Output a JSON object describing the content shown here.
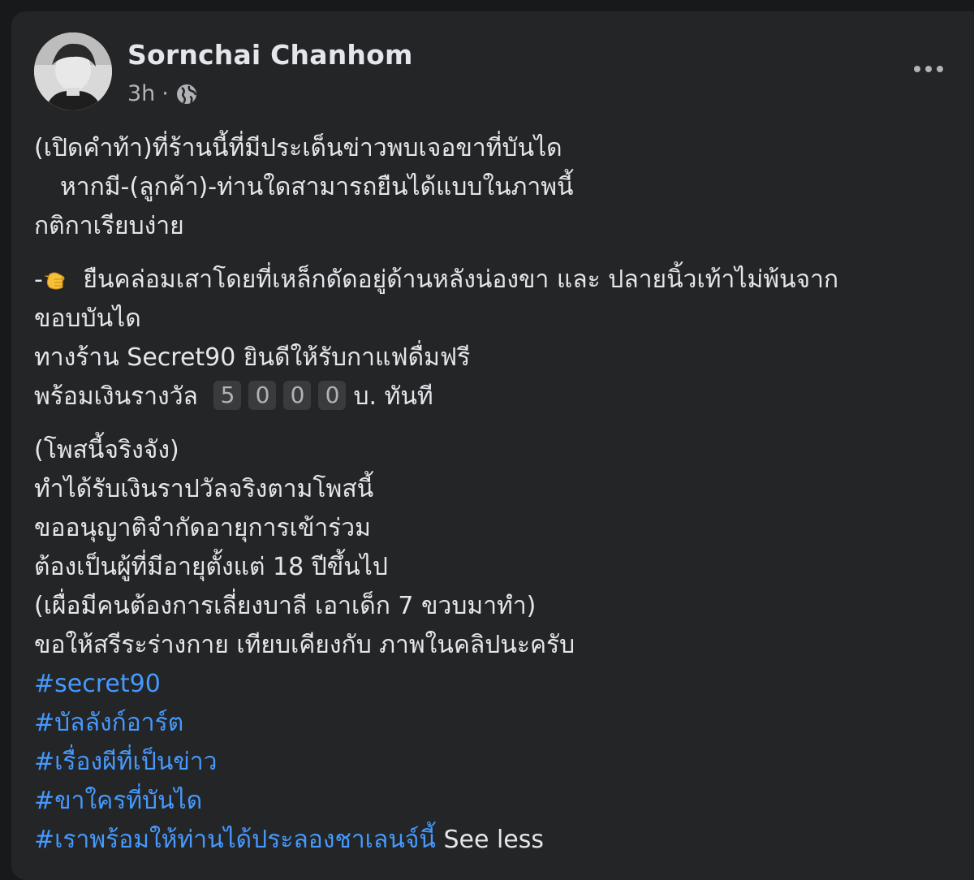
{
  "post": {
    "author": "Sornchai Chanhom",
    "time": "3h",
    "separator": "·",
    "privacy_icon": "globe-icon",
    "more_icon": "more-options-icon",
    "intro_lines": [
      "(เปิดคำท้า)ที่ร้านนี้ที่มีประเด็นข่าวพบเจอขาที่บันได",
      "หากมี-(ลูกค้า)-ท่านใดสามารถยืนได้แบบในภาพนี้",
      "กติกาเรียบง่าย"
    ],
    "rule": {
      "prefix": "-",
      "emoji": "pointing-hand-icon",
      "line1": "ยืนคล่อมเสาโดยที่เหล็กดัดอยู่ด้านหลังน่องขา และ ปลายนิ้วเท้าไม่พ้นจาก",
      "line2": "ขอบบันได",
      "line3": "ทางร้าน Secret90 ยินดีให้รับกาแฟดื่มฟรี",
      "prize_prefix": "พร้อมเงินรางวัล",
      "prize_digits": [
        "5",
        "0",
        "0",
        "0"
      ],
      "prize_suffix": "บ. ทันที"
    },
    "closing_lines": [
      "(โพสนี้จริงจัง)",
      "ทำได้รับเงินราปวัลจริงตามโพสนี้",
      "ขออนุญาติจำกัดอายุการเข้าร่วม",
      "ต้องเป็นผู้ที่มีอายุตั้งแต่ 18 ปีขึ้นไป",
      "(เผื่อมีคนต้องการเลี่ยงบาลี เอาเด็ก 7 ขวบมาทำ)",
      "ขอให้สรีระร่างกาย เทียบเคียงกับ ภาพในคลิปนะครับ"
    ],
    "hashtags": [
      "#secret90",
      "#บัลลังก์อาร์ต",
      "#เรื่องผีที่เป็นข่าว",
      "#ขาใครที่บันได",
      "#เราพร้อมให้ท่านได้ประลองชาเลนจ์นี้"
    ],
    "see_less": "See less"
  },
  "colors": {
    "background": "#18191a",
    "card": "#242526",
    "text": "#e4e6eb",
    "secondary": "#b0b3b8",
    "link": "#4599ff"
  }
}
